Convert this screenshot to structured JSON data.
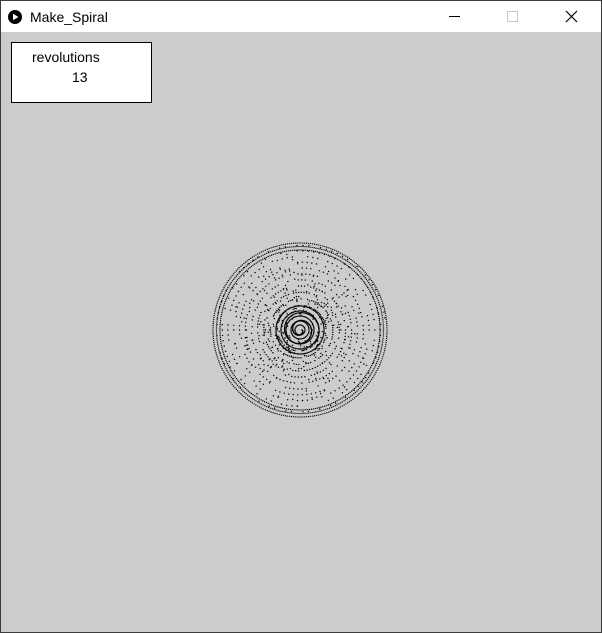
{
  "window": {
    "title": "Make_Spiral"
  },
  "icons": {
    "app": "processing-play-icon",
    "minimize": "minimize-icon",
    "maximize": "maximize-icon",
    "close": "close-icon"
  },
  "info": {
    "label": "revolutions",
    "value": "13"
  },
  "colors": {
    "canvas_bg": "#cccccc",
    "dots": "#000000",
    "titlebar": "#ffffff"
  }
}
